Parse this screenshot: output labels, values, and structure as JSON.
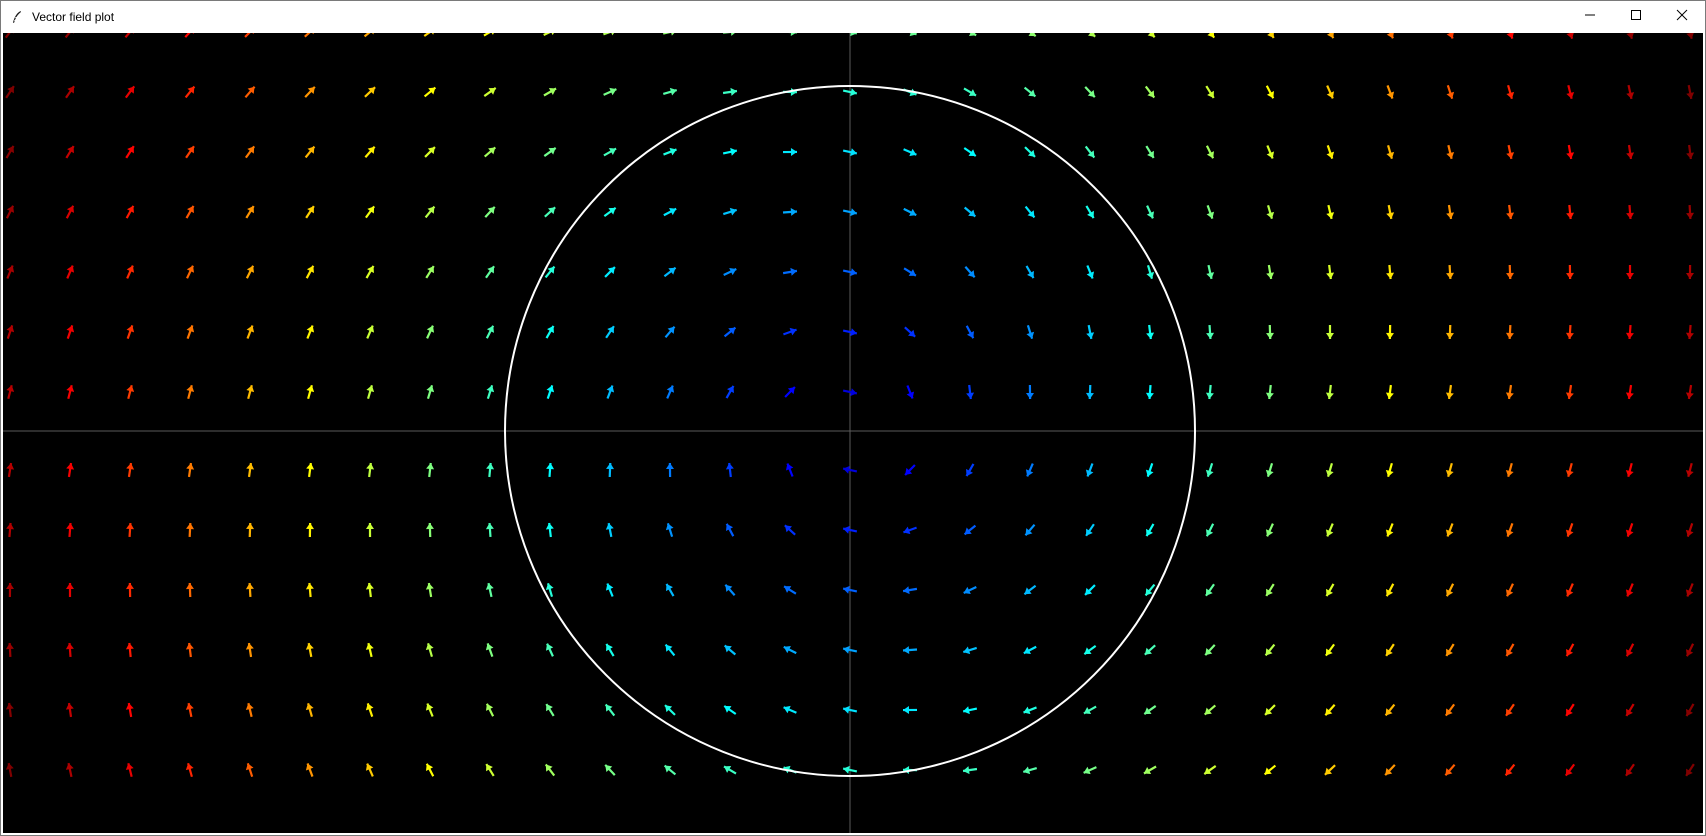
{
  "window": {
    "title": "Vector field plot",
    "app_icon": "feather-icon",
    "controls": {
      "minimize_icon": "minimize-icon",
      "maximize_icon": "maximize-icon",
      "close_icon": "close-icon"
    }
  },
  "plot": {
    "background_color": "#000000",
    "axis_color": "#5a5a5a",
    "circle_color": "#ffffff",
    "colormap": "jet (blue at center, red at edges)",
    "grid_columns": 29,
    "grid_rows": 14
  }
}
